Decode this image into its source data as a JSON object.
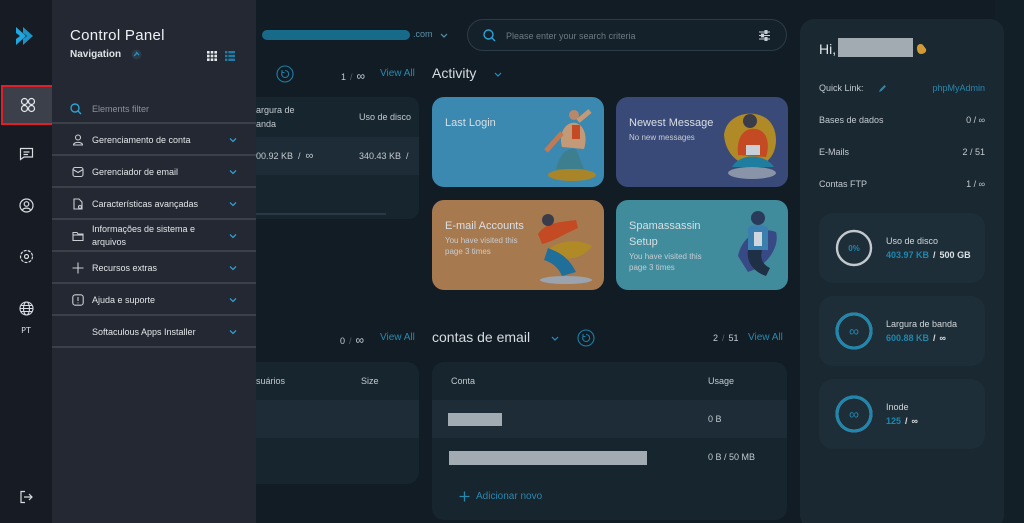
{
  "rail": {
    "items": [
      {
        "name": "dashboard",
        "icon": "apps-icon",
        "active": true
      },
      {
        "name": "messages",
        "icon": "message-icon"
      },
      {
        "name": "profile",
        "icon": "user-circle-icon"
      },
      {
        "name": "settings",
        "icon": "gear-icon"
      },
      {
        "name": "language",
        "icon": "globe-icon"
      }
    ],
    "language_label": "PT",
    "logout_icon": "logout-icon"
  },
  "nav": {
    "title": "Control Panel",
    "subtitle": "Navigation",
    "pin_icon": "pin-icon",
    "filter_placeholder": "Elements filter",
    "items": [
      {
        "label": "Gerenciamento de conta",
        "icon": "user-icon"
      },
      {
        "label": "Gerenciador de email",
        "icon": "mail-icon"
      },
      {
        "label": "Características avançadas",
        "icon": "file-settings-icon"
      },
      {
        "label": "Informações de sistema e arquivos",
        "icon": "folder-icon"
      },
      {
        "label": "Recursos extras",
        "icon": "plus-icon"
      },
      {
        "label": "Ajuda e suporte",
        "icon": "alert-icon"
      },
      {
        "label": "Softaculous Apps Installer",
        "icon": ""
      }
    ]
  },
  "header": {
    "domain_suffix": ".com",
    "search_placeholder": "Please enter your search criteria"
  },
  "sites_section": {
    "count": "1",
    "limit": "∞",
    "view_all": "View All",
    "columns": [
      "argura de\nanda",
      "Uso de disco"
    ],
    "rows": [
      {
        "bandwidth": "00.92 KB",
        "bandwidth_limit": "∞",
        "disk": "340.43 KB",
        "disk_sep": "/"
      }
    ]
  },
  "activity": {
    "title": "Activity",
    "tiles": [
      {
        "title": "Last Login",
        "subtitle": "",
        "color": "#3b88b1"
      },
      {
        "title": "Newest Message",
        "subtitle": "No new messages",
        "color": "#3a4a78"
      },
      {
        "title": "E-mail Accounts",
        "subtitle": "You have visited this page 3 times",
        "color": "#a7794f"
      },
      {
        "title": "Spamassassin Setup",
        "subtitle": "You have visited this page 3 times",
        "color": "#418c9c"
      }
    ]
  },
  "ftp_section": {
    "count": "0",
    "limit": "∞",
    "view_all": "View All",
    "columns": [
      "suários",
      "Size"
    ]
  },
  "email_section": {
    "title": "contas de email",
    "count": "2",
    "limit": "51",
    "view_all": "View All",
    "columns": [
      "Conta",
      "Usage"
    ],
    "rows": [
      {
        "account": "",
        "usage": "0 B"
      },
      {
        "account": "",
        "usage": "0 B / 50 MB"
      }
    ],
    "add_new": "Adicionar novo"
  },
  "right_panel": {
    "greeting": "Hi,",
    "quick_link_label": "Quick Link:",
    "quick_link_value": "phpMyAdmin",
    "stats": [
      {
        "label": "Bases de dados",
        "value": "0 / ∞"
      },
      {
        "label": "E-Mails",
        "value": "2 / 51"
      },
      {
        "label": "Contas FTP",
        "value": "1 / ∞"
      }
    ],
    "usage_cards": [
      {
        "label": "Uso de disco",
        "used": "403.97 KB",
        "limit": "500 GB",
        "ring_text": "0%",
        "percent": 0
      },
      {
        "label": "Largura de banda",
        "used": "600.88 KB",
        "limit": "∞",
        "ring_text": "∞",
        "percent": 100
      },
      {
        "label": "Inode",
        "used": "125",
        "limit": "∞",
        "ring_text": "∞",
        "percent": 100
      }
    ]
  },
  "colors": {
    "accent": "#1f86ad",
    "highlight_border": "#e21f26"
  }
}
